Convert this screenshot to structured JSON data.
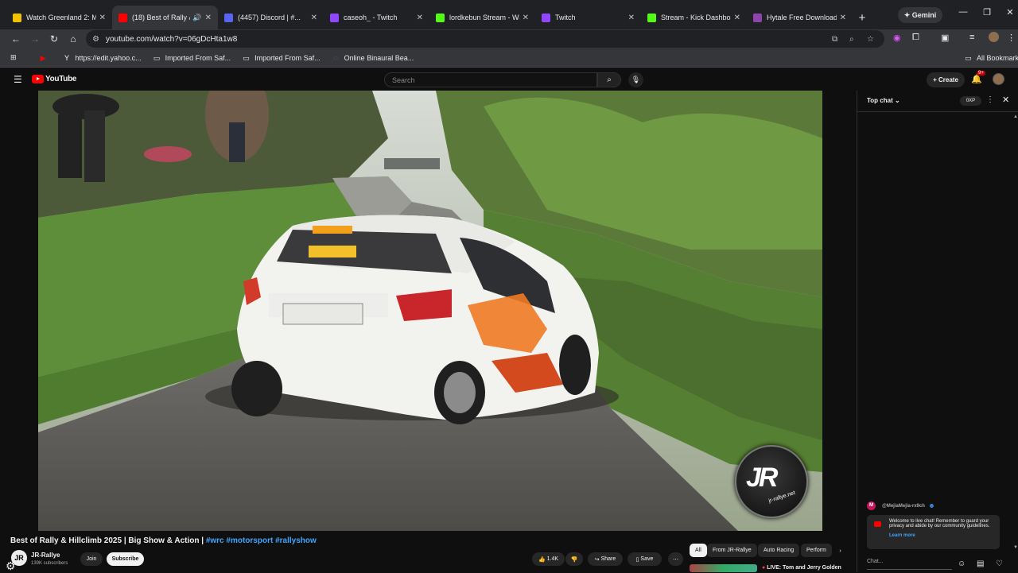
{
  "tabs": [
    {
      "title": "Watch Greenland 2: Mi...",
      "icon": "video-icon",
      "color": "#f2c200"
    },
    {
      "title": "(18) Best of Rally &...",
      "icon": "youtube-icon",
      "color": "#ff0000",
      "active": true
    },
    {
      "title": "(4457) Discord | #...",
      "icon": "discord-icon",
      "color": "#5865f2"
    },
    {
      "title": "caseoh_ - Twitch",
      "icon": "twitch-icon",
      "color": "#9146ff"
    },
    {
      "title": "lordkebun Stream - Wa...",
      "icon": "kick-icon",
      "color": "#53fc18"
    },
    {
      "title": "Twitch",
      "icon": "twitch-icon",
      "color": "#9146ff"
    },
    {
      "title": "Stream - Kick Dashboa...",
      "icon": "kick-icon",
      "color": "#53fc18"
    },
    {
      "title": "Hytale Free Download ...",
      "icon": "web-icon",
      "color": "#8e44ad"
    }
  ],
  "gemini_label": "Gemini",
  "url": "youtube.com/watch?v=06gDcHta1w8",
  "bookmarks": [
    {
      "label": "",
      "icon": "youtube-icon"
    },
    {
      "label": "https://edit.yahoo.c...",
      "icon": "yahoo-icon"
    },
    {
      "label": "Imported From Saf...",
      "icon": "folder-icon"
    },
    {
      "label": "Imported From Saf...",
      "icon": "folder-icon"
    },
    {
      "label": "Online Binaural Bea...",
      "icon": "web-icon"
    }
  ],
  "all_bookmarks": "All Bookmarks",
  "youtube": {
    "logo": "YouTube",
    "search_placeholder": "Search",
    "create_label": "Create",
    "notif_count": "9+"
  },
  "video": {
    "title": "Best of Rally & Hillclimb 2025 | Big Show & Action | ",
    "tags": "#wrc #motorsport #rallyshow",
    "channel": "JR-Rallye",
    "subscribers": "139K subscribers",
    "join": "Join",
    "subscribe": "Subscribe",
    "likes": "1.4K",
    "share": "Share",
    "save": "Save",
    "logo_text": "JR",
    "logo_sub": "jr-rallye.net"
  },
  "chips": [
    "All",
    "From JR-Rallye",
    "Auto Racing",
    "Perform"
  ],
  "rec": {
    "title": "LIVE: Tom and Jerry Golden"
  },
  "chat": {
    "mode": "Top chat",
    "xp": "0XP",
    "user": "@MejiaMejia-rx9ch",
    "notice": "Welcome to live chat! Remember to guard your privacy and abide by our community guidelines.",
    "learn_more": "Learn more",
    "placeholder": "Chat..."
  }
}
